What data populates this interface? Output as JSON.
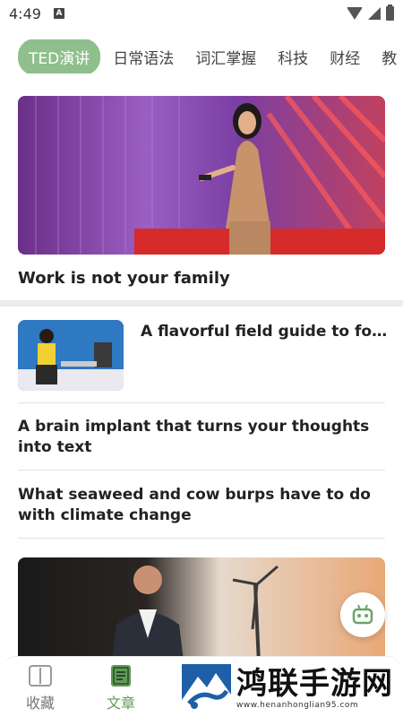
{
  "status_bar": {
    "time": "4:49",
    "notification_badge": "A"
  },
  "tabs": [
    {
      "label": "TED演讲",
      "active": true
    },
    {
      "label": "日常语法"
    },
    {
      "label": "词汇掌握"
    },
    {
      "label": "科技"
    },
    {
      "label": "财经"
    },
    {
      "label": "教"
    }
  ],
  "featured": {
    "title": "Work is not your family"
  },
  "articles": [
    {
      "title": "A flavorful field guide to foraging"
    },
    {
      "title": "A brain implant that turns your thoughts into text"
    },
    {
      "title": "What seaweed and cow burps have to do with climate change"
    }
  ],
  "bottom_nav": [
    {
      "label": "收藏"
    },
    {
      "label": "文章",
      "active": true
    }
  ],
  "watermark": {
    "brand": "鸿联手游网",
    "url": "www.henanhonglian95.com"
  },
  "colors": {
    "accent": "#8fbf8c",
    "active_nav": "#5f9a55",
    "watermark_blue": "#1e5fa8"
  }
}
